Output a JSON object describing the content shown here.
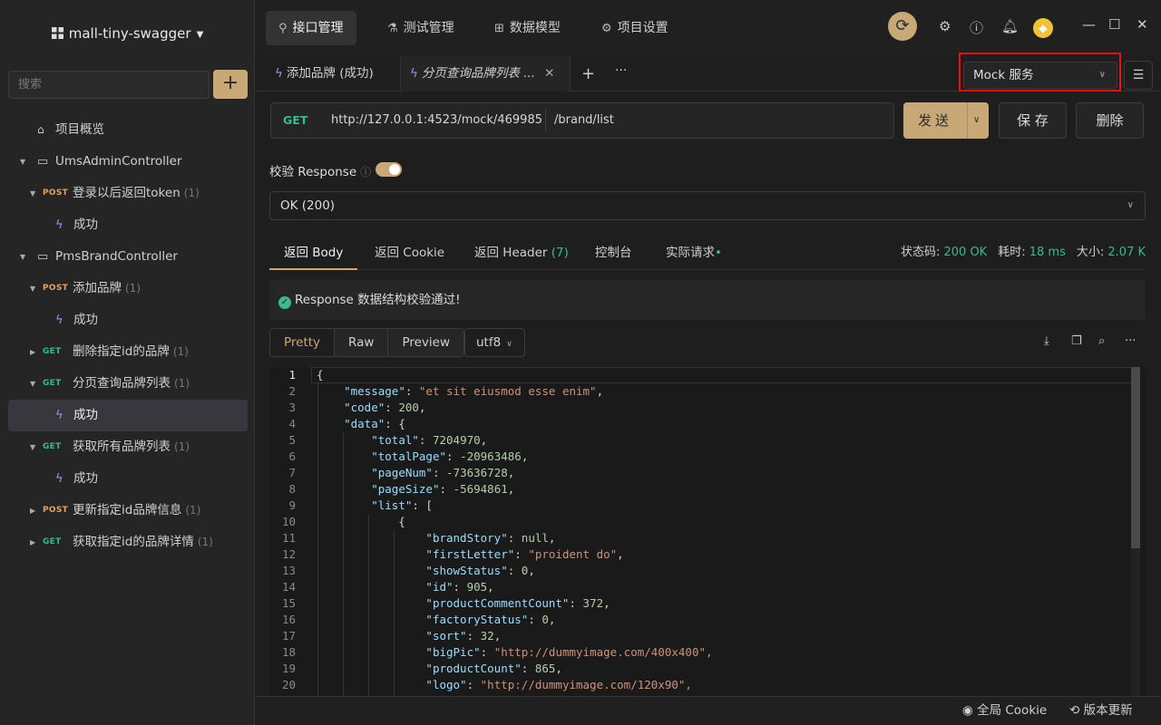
{
  "sidebar": {
    "project_name": "mall-tiny-swagger",
    "search_placeholder": "搜索",
    "add_label": "+",
    "overview": "项目概览",
    "items": [
      {
        "type": "folder",
        "label": "UmsAdminController"
      },
      {
        "type": "api",
        "method": "POST",
        "label": "登录以后返回token",
        "count": "(1)"
      },
      {
        "type": "case",
        "label": "成功"
      },
      {
        "type": "folder",
        "label": "PmsBrandController"
      },
      {
        "type": "api",
        "method": "POST",
        "label": "添加品牌",
        "count": "(1)"
      },
      {
        "type": "case",
        "label": "成功"
      },
      {
        "type": "api",
        "method": "GET",
        "label": "删除指定id的品牌",
        "count": "(1)"
      },
      {
        "type": "api",
        "method": "GET",
        "label": "分页查询品牌列表",
        "count": "(1)"
      },
      {
        "type": "case",
        "label": "成功"
      },
      {
        "type": "api",
        "method": "GET",
        "label": "获取所有品牌列表",
        "count": "(1)"
      },
      {
        "type": "case",
        "label": "成功"
      },
      {
        "type": "api",
        "method": "POST",
        "label": "更新指定id品牌信息",
        "count": "(1)"
      },
      {
        "type": "api",
        "method": "GET",
        "label": "获取指定id的品牌详情",
        "count": "(1)"
      }
    ]
  },
  "topnav": {
    "tabs": [
      "接口管理",
      "测试管理",
      "数据模型",
      "项目设置"
    ]
  },
  "doctabs": {
    "tab1": "添加品牌 (成功)",
    "tab2": "分页查询品牌列表 ...",
    "add": "+",
    "more": "···",
    "env": "Mock 服务"
  },
  "request": {
    "method": "GET",
    "host": "http://127.0.0.1:4523/mock/469985",
    "path": "/brand/list",
    "send": "发送",
    "save": "保 存",
    "delete": "删除"
  },
  "verify": {
    "label": "校验 Response",
    "status_option": "OK (200)"
  },
  "response_tabs": {
    "body": "返回 Body",
    "cookie": "返回 Cookie",
    "header": "返回 Header",
    "header_count": "(7)",
    "console": "控制台",
    "actual": "实际请求",
    "status_label": "状态码:",
    "status_value": "200 OK",
    "time_label": "耗时:",
    "time_value": "18 ms",
    "size_label": "大小:",
    "size_value": "2.07 K"
  },
  "validation_msg": "Response 数据结构校验通过!",
  "view_modes": [
    "Pretty",
    "Raw",
    "Preview"
  ],
  "encoding": "utf8",
  "code_lines": [
    "{",
    "    \"message\": \"et sit eiusmod esse enim\",",
    "    \"code\": 200,",
    "    \"data\": {",
    "        \"total\": 7204970,",
    "        \"totalPage\": -20963486,",
    "        \"pageNum\": -73636728,",
    "        \"pageSize\": -5694861,",
    "        \"list\": [",
    "            {",
    "                \"brandStory\": null,",
    "                \"firstLetter\": \"proident do\",",
    "                \"showStatus\": 0,",
    "                \"id\": 905,",
    "                \"productCommentCount\": 372,",
    "                \"factoryStatus\": 0,",
    "                \"sort\": 32,",
    "                \"bigPic\": \"http://dummyimage.com/400x400\",",
    "                \"productCount\": 865,",
    "                \"logo\": \"http://dummyimage.com/120x90\","
  ],
  "bottom": {
    "cookie": "全局 Cookie",
    "update": "版本更新"
  }
}
